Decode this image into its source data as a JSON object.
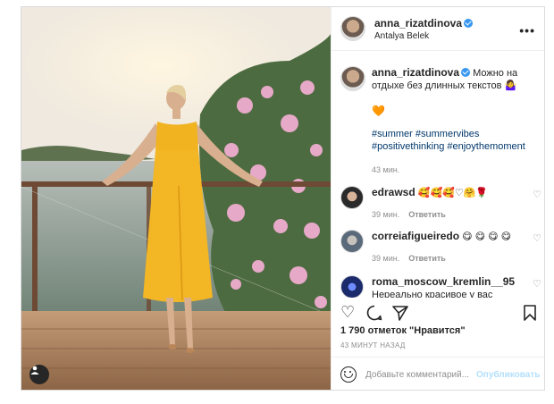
{
  "header": {
    "username": "anna_rizatdinova",
    "location": "Antalya Belek"
  },
  "caption": {
    "username": "anna_rizatdinova",
    "text": "Можно на отдыхе без длинных текстов 🤷‍♀️",
    "emoji": "🧡",
    "hashtags": "#summer #summervibes #positivethinking #enjoythemoment",
    "time": "43 мин."
  },
  "comments": [
    {
      "username": "edrawsd",
      "text": "🥰🥰🥰♡🤗🌹",
      "time": "39 мин.",
      "reply": "Ответить"
    },
    {
      "username": "correiafigueiredo",
      "text": "😋 😋 😋 😋",
      "time": "39 мин.",
      "reply": "Ответить"
    },
    {
      "username": "roma_moscow_kremlin__95",
      "text": "Нереально красивое у вас",
      "time": "",
      "reply": ""
    }
  ],
  "likes": "1 790 отметок \"Нравится\"",
  "timeago": "43 МИНУТ НАЗАД",
  "add_comment": {
    "placeholder": "Добавьте комментарий...",
    "publish": "Опубликовать"
  },
  "icons": {
    "more": "more-options-icon",
    "like": "heart-icon",
    "comment": "comment-icon",
    "share": "paper-plane-icon",
    "save": "bookmark-icon",
    "emoji": "smiley-icon",
    "user_tag": "user-tag-icon"
  }
}
